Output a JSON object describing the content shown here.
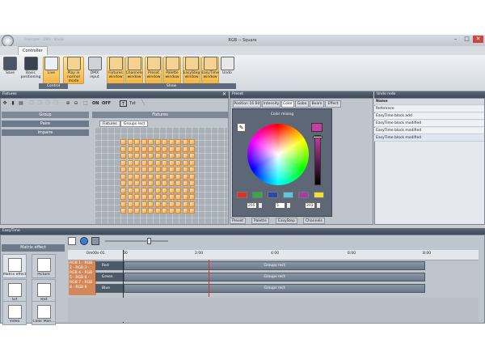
{
  "window": {
    "title": "RGB -- Square",
    "faint_left": "Freestyler · DMX · Studio",
    "min": "–",
    "max": "□",
    "close": "✕"
  },
  "tabs": [
    "Controller"
  ],
  "ribbon": {
    "buttons": [
      {
        "label": "Save",
        "icon": "save-icon"
      },
      {
        "label": "Basic positioning",
        "icon": "positioning-icon"
      },
      {
        "label": "Live",
        "icon": "live-icon"
      },
      {
        "label": "Play in normal mode",
        "icon": "play-icon"
      },
      {
        "label": "DMX input",
        "icon": "dmx-icon"
      },
      {
        "label": "Fixtures window",
        "icon": "fixtures-icon"
      },
      {
        "label": "Channels window",
        "icon": "channels-icon"
      },
      {
        "label": "Preset window",
        "icon": "preset-icon"
      },
      {
        "label": "Palette window",
        "icon": "palette-icon"
      },
      {
        "label": "EasyStep window",
        "icon": "easystep-icon"
      },
      {
        "label": "EasyTime window",
        "icon": "easytime-icon"
      },
      {
        "label": "Undo",
        "icon": "undo-icon"
      }
    ],
    "groups": [
      "Control",
      "Show"
    ]
  },
  "fixtures_panel": {
    "title": "Fixtures",
    "toolbar": {
      "on": "ON",
      "off": "OFF",
      "txt": "Txt"
    },
    "group_header": "Group",
    "groups": [
      "Paire",
      "Impaire"
    ],
    "fixtures_header": "Fixtures",
    "subtabs": [
      "Fixtures",
      "Groups rect"
    ]
  },
  "preset_panel": {
    "title": "Preset",
    "tabs": [
      "Position 16 Bit",
      "Intensity",
      "Color",
      "Gobo",
      "Beam",
      "Effect"
    ],
    "color_mixing": "Color mixing",
    "values": [
      "255",
      "5",
      "203"
    ],
    "swatches": [
      "#e0302a",
      "#3aa844",
      "#2b49a8",
      "#5ec6e0",
      "#a23fa4",
      "#eee23a"
    ],
    "bottom_tabs": [
      "Preset",
      "Palette",
      "EasyStep",
      "Channels"
    ]
  },
  "undo_panel": {
    "title": "Undo redo",
    "header": "Name",
    "rows": [
      "Reference",
      "EasyTime block add",
      "EasyTime block modified",
      "EasyTime block modified",
      "EasyTime block modified"
    ]
  },
  "easytime": {
    "title": "EasyTime",
    "lib_header": "Matrix effect",
    "lib_items": [
      {
        "label": "Matrix effect",
        "icon": "matrix-effect-icon"
      },
      {
        "label": "Picture",
        "icon": "picture-icon"
      },
      {
        "label": "Gif",
        "icon": "gif-icon"
      },
      {
        "label": "Text",
        "icon": "text-icon"
      },
      {
        "label": "Video",
        "icon": "video-icon"
      },
      {
        "label": "Color Man...",
        "icon": "color-manager-icon"
      }
    ],
    "time_marks": [
      "0m00s-01",
      "00",
      "2:00",
      "4:00",
      "6:00",
      "8:00"
    ],
    "groups_label": "RGB 1 - RGB 2 - RGB 3 - RGB 4 - RGB 5 - RGB 6 - RGB 7 - RGB 8 - RGB 9",
    "tracks": [
      {
        "name": "Red",
        "block": "Groups rect"
      },
      {
        "name": "Green",
        "block": "Groups rect"
      },
      {
        "name": "Blue",
        "block": "Groups rect"
      }
    ]
  }
}
